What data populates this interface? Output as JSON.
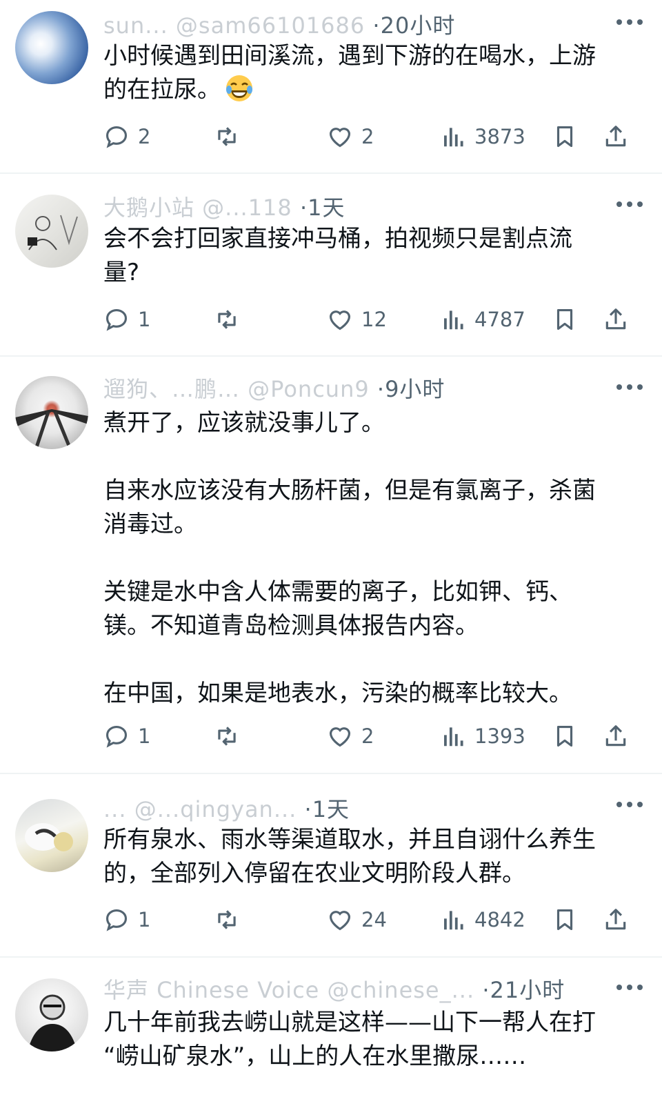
{
  "posts": [
    {
      "handle": "sun... @sam66101686",
      "time": "20小时",
      "text": "小时候遇到田间溪流，遇到下游的在喝水，上游\n的在拉尿。",
      "emoji": "laughing-tears-emoji",
      "replies": "2",
      "likes": "2",
      "views": "3873"
    },
    {
      "handle": "大鹅小站 @...118",
      "time": "1天",
      "text": "会不会打回家直接冲马桶，拍视频只是割点流\n量?",
      "replies": "1",
      "likes": "12",
      "views": "4787"
    },
    {
      "handle": "遛狗、…鹏… @Poncun9",
      "time": "9小时",
      "text": "煮开了，应该就没事儿了。\n\n自来水应该没有大肠杆菌，但是有氯离子，杀菌\n消毒过。\n\n关键是水中含人体需要的离子，比如钾、钙、\n镁。不知道青岛检测具体报告内容。\n\n在中国，如果是地表水，污染的概率比较大。",
      "replies": "1",
      "likes": "2",
      "views": "1393"
    },
    {
      "handle": "... @...qingyan...",
      "time": "1天",
      "text": "所有泉水、雨水等渠道取水，并且自诩什么养生\n的，全部列入停留在农业文明阶段人群。",
      "replies": "1",
      "likes": "24",
      "views": "4842"
    },
    {
      "handle": "华声 Chinese Voice @chinese_...",
      "time": "21小时",
      "text": "几十年前我去崂山就是这样——山下一帮人在打\n“崂山矿泉水”，山上的人在水里撒尿……"
    }
  ],
  "icons": {
    "reply": "reply-icon",
    "repost": "repost-icon",
    "like": "heart-icon",
    "views": "views-icon",
    "bookmark": "bookmark-icon",
    "share": "share-icon",
    "more": "more-icon"
  },
  "colors": {
    "text": "#0f1419",
    "muted": "#536471",
    "divider": "#eff3f4"
  }
}
